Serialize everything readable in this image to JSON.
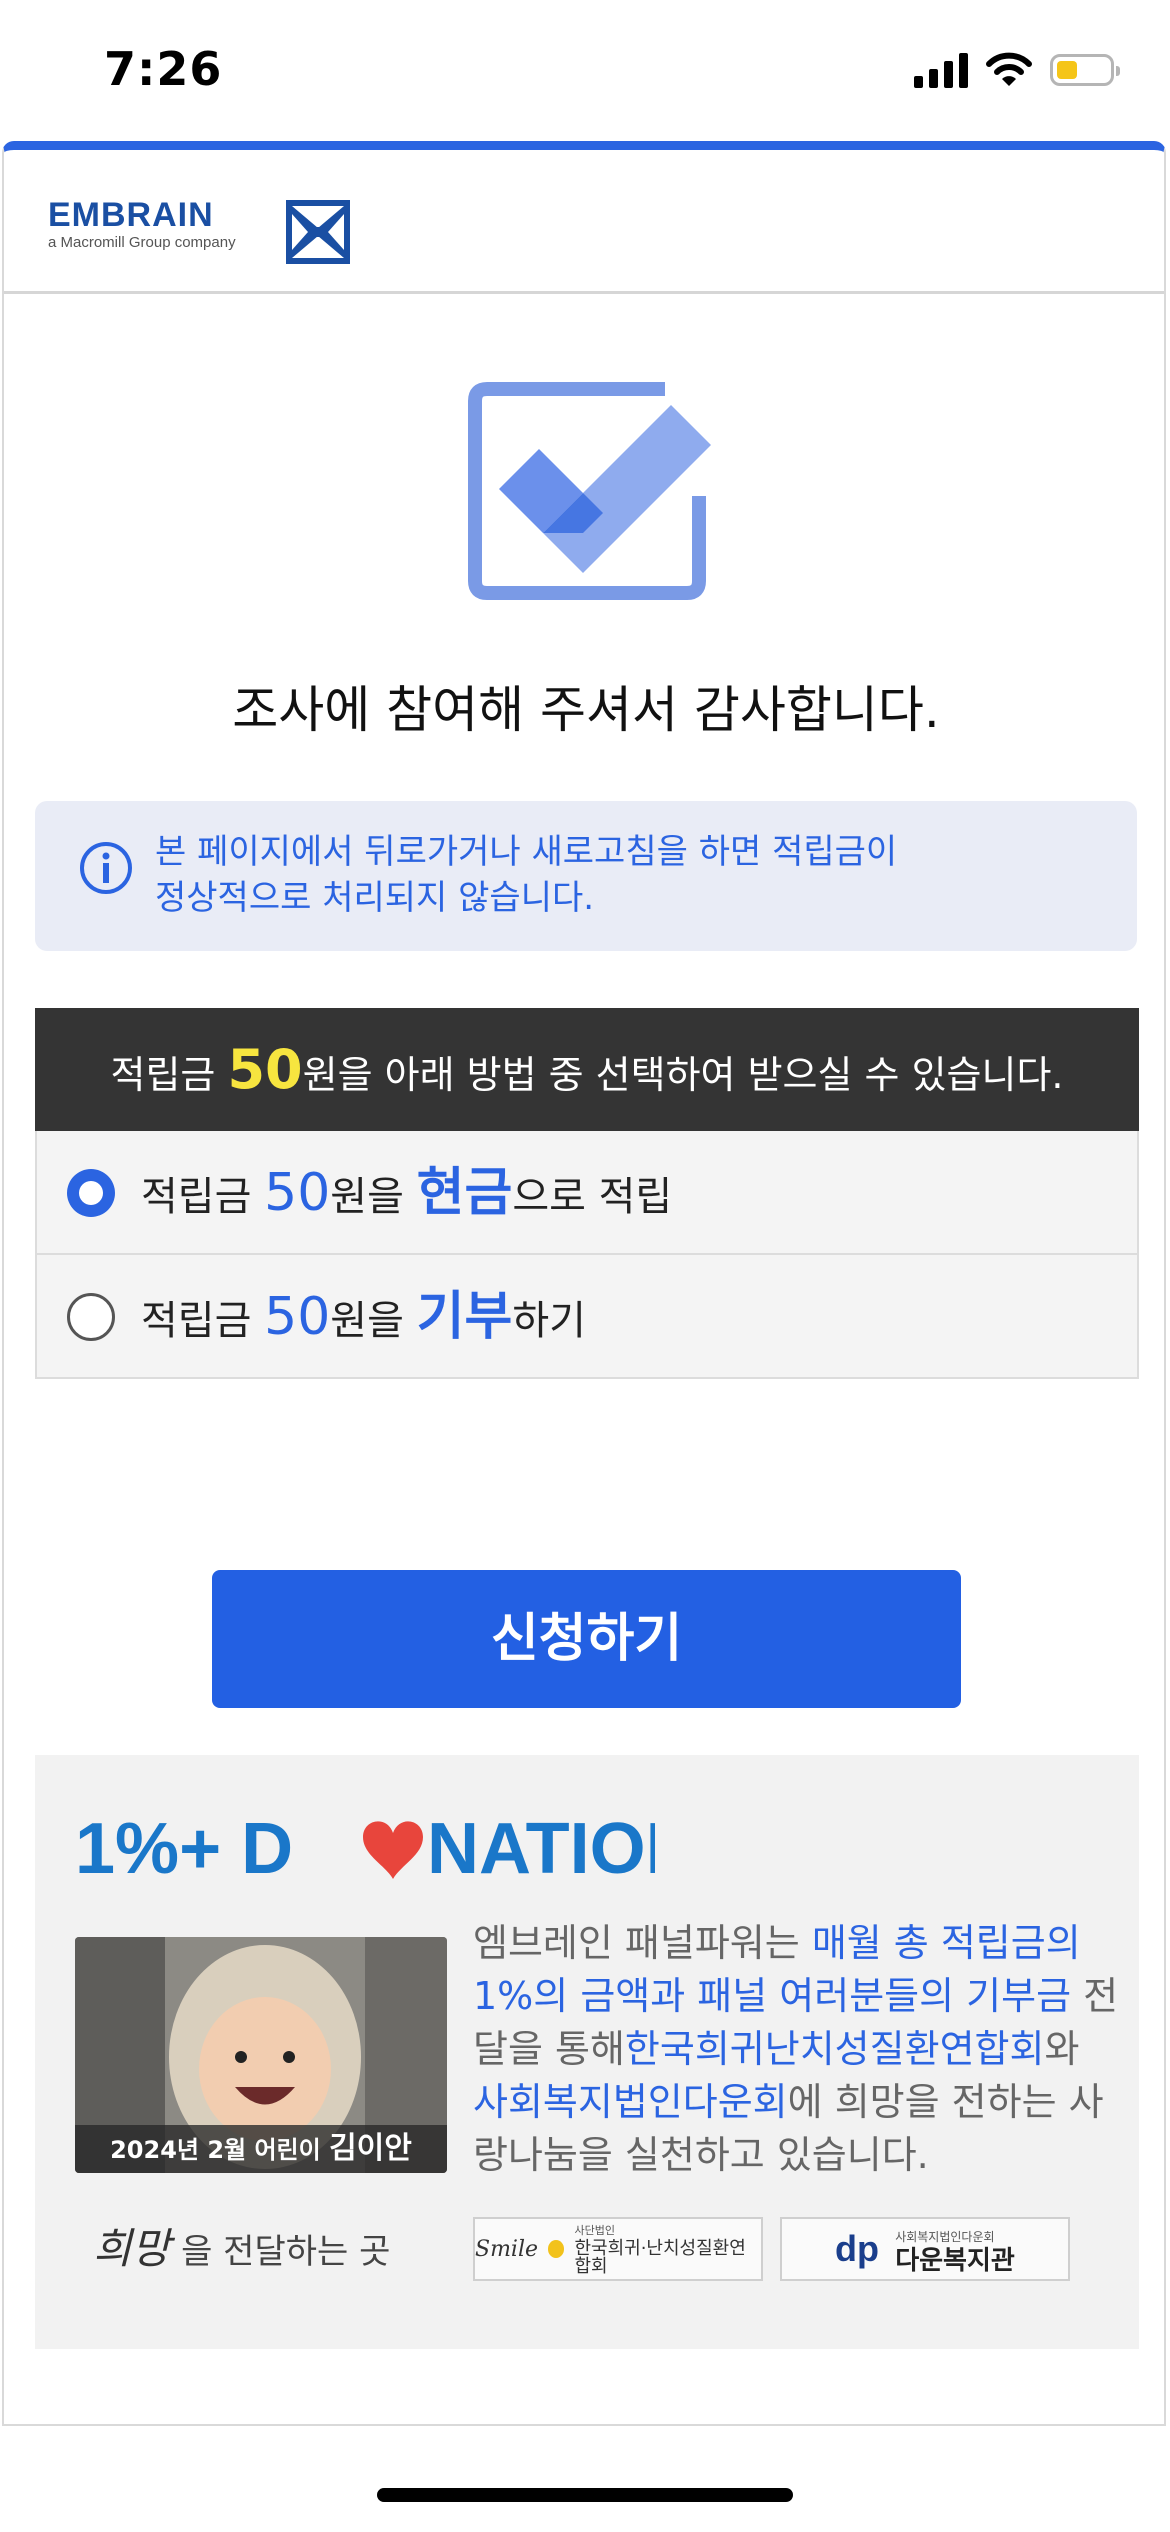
{
  "status_bar": {
    "time": "7:26"
  },
  "header": {
    "logo_main": "EMBRAIN",
    "logo_sub": "a Macromill Group company"
  },
  "thanks_message": "조사에 참여해 주셔서 감사합니다.",
  "notice": {
    "line1": "본 페이지에서 뒤로가거나 새로고침을 하면 적립금이",
    "line2": "정상적으로 처리되지 않습니다."
  },
  "options": {
    "header_pre": "적립금 ",
    "header_amount": "50",
    "header_post": "원을 아래 방법 중 선택하여 받으실 수 있습니다.",
    "items": [
      {
        "pre": "적립금 ",
        "amount": "50",
        "mid": "원을 ",
        "method": "현금",
        "post": "으로 적립",
        "selected": true
      },
      {
        "pre": "적립금 ",
        "amount": "50",
        "mid": "원을 ",
        "method": "기부",
        "post": "하기",
        "selected": false
      }
    ]
  },
  "apply_button": "신청하기",
  "donation": {
    "title": "1%+ D",
    "title_tail": "NATION",
    "photo_caption_pre": "2024년 2월 어린이 ",
    "photo_caption_name": "김이안",
    "text": {
      "t1": "엠브레인 패널파워는 ",
      "h1": "매월 총 적립금의 1%의 금액과 패널 여러분들의 기부금",
      "t2": " 전달을 통해",
      "h2": "한국희귀난치성질환연합회",
      "t3": "와 ",
      "h3": "사회복지법인다운회",
      "t4": "에 희망을 전하는 사랑나눔을 실천하고 있습니다."
    },
    "hope_script": "희망",
    "hope_text": "을 전달하는 곳",
    "partner1_script": "Smile",
    "partner1_small": "사단법인",
    "partner1_name": "한국희귀·난치성질환연합회",
    "partner2_small": "사회복지법인다운회",
    "partner2_name": "다운복지관"
  },
  "colors": {
    "accent": "#2360e3",
    "highlight": "#f7e53f",
    "dark_header": "#343434"
  }
}
